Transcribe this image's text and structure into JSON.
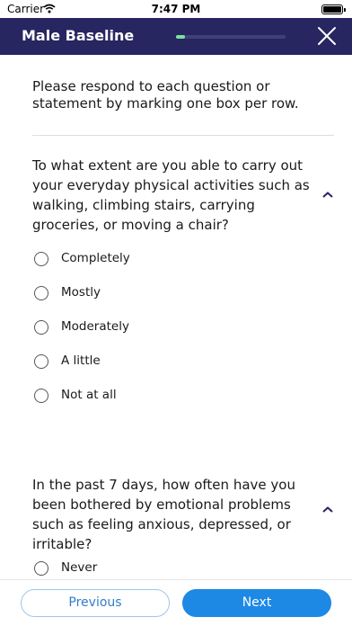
{
  "status_bar": {
    "carrier": "Carrier",
    "time": "7:47 PM",
    "icons": [
      "wifi-icon",
      "battery-icon"
    ]
  },
  "header": {
    "title": "Male Baseline",
    "progress_fraction": 0.08,
    "close_icon": "close-icon",
    "background_color": "#272661",
    "progress_color": "#7ee0a1"
  },
  "survey": {
    "intro": "Please respond to each question or statement by marking one box per row.",
    "questions": [
      {
        "text": "To what extent are you able to carry out your everyday physical activities such as walking, climbing stairs, carrying groceries, or moving a chair?",
        "expanded_icon": "chevron-up-icon",
        "options": [
          "Completely",
          "Mostly",
          "Moderately",
          "A little",
          "Not at all"
        ]
      },
      {
        "text": "In the past 7 days, how often have you been bothered by emotional problems such as feeling anxious, depressed, or irritable?",
        "expanded_icon": "chevron-up-icon",
        "options": [
          "Never"
        ]
      }
    ]
  },
  "footer": {
    "previous_label": "Previous",
    "next_label": "Next",
    "accent_color": "#1e88e5"
  }
}
